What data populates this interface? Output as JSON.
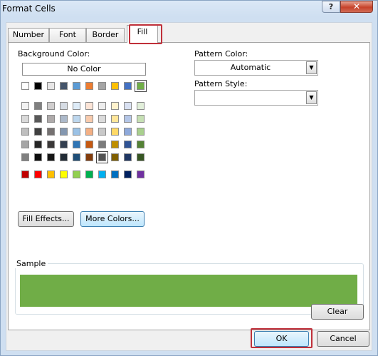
{
  "window": {
    "title": "Format Cells",
    "help_glyph": "?",
    "close_glyph": "✕"
  },
  "tabs": [
    {
      "label": "Number"
    },
    {
      "label": "Font"
    },
    {
      "label": "Border"
    },
    {
      "label": "Fill",
      "active": true
    }
  ],
  "fill": {
    "background_color_label": "Background Color:",
    "no_color_label": "No Color",
    "selected_color": "#70ad47",
    "theme_row": [
      "#ffffff",
      "#000000",
      "#e7e6e6",
      "#44546a",
      "#5b9bd5",
      "#ed7d31",
      "#a5a5a5",
      "#ffc000",
      "#4472c4",
      "#70ad47"
    ],
    "tint_rows": [
      [
        "#f2f2f2",
        "#808080",
        "#d0cece",
        "#d6dce4",
        "#ddebf7",
        "#fce4d6",
        "#ededed",
        "#fff2cc",
        "#d9e1f2",
        "#e2efda"
      ],
      [
        "#d9d9d9",
        "#595959",
        "#aeaaaa",
        "#acb9ca",
        "#bdd7ee",
        "#f8cbad",
        "#dbdbdb",
        "#ffe699",
        "#b4c6e7",
        "#c6e0b4"
      ],
      [
        "#bfbfbf",
        "#404040",
        "#757171",
        "#8497b0",
        "#9bc2e6",
        "#f4b084",
        "#c9c9c9",
        "#ffd966",
        "#8ea9db",
        "#a9d08e"
      ],
      [
        "#a6a6a6",
        "#262626",
        "#3a3838",
        "#333f4f",
        "#2f75b5",
        "#c65911",
        "#7b7b7b",
        "#bf8f00",
        "#305496",
        "#548235"
      ],
      [
        "#808080",
        "#0d0d0d",
        "#161616",
        "#222b35",
        "#1f4e78",
        "#833c0c",
        "#525252",
        "#806000",
        "#203764",
        "#375623"
      ]
    ],
    "standard_row": [
      "#c00000",
      "#ff0000",
      "#ffc000",
      "#ffff00",
      "#92d050",
      "#00b050",
      "#00b0f0",
      "#0070c0",
      "#002060",
      "#7030a0"
    ],
    "selected_tint_cell": "row 5, column 7",
    "fill_effects_label": "Fill Effects...",
    "more_colors_label": "More Colors...",
    "pattern_color_label": "Pattern Color:",
    "pattern_color_value": "Automatic",
    "pattern_style_label": "Pattern Style:",
    "pattern_style_value": "",
    "sample_label": "Sample",
    "clear_label": "Clear"
  },
  "footer": {
    "ok_label": "OK",
    "cancel_label": "Cancel"
  },
  "colors": {
    "highlight_outline": "#c0303a",
    "sample_fill": "#70ad47"
  }
}
